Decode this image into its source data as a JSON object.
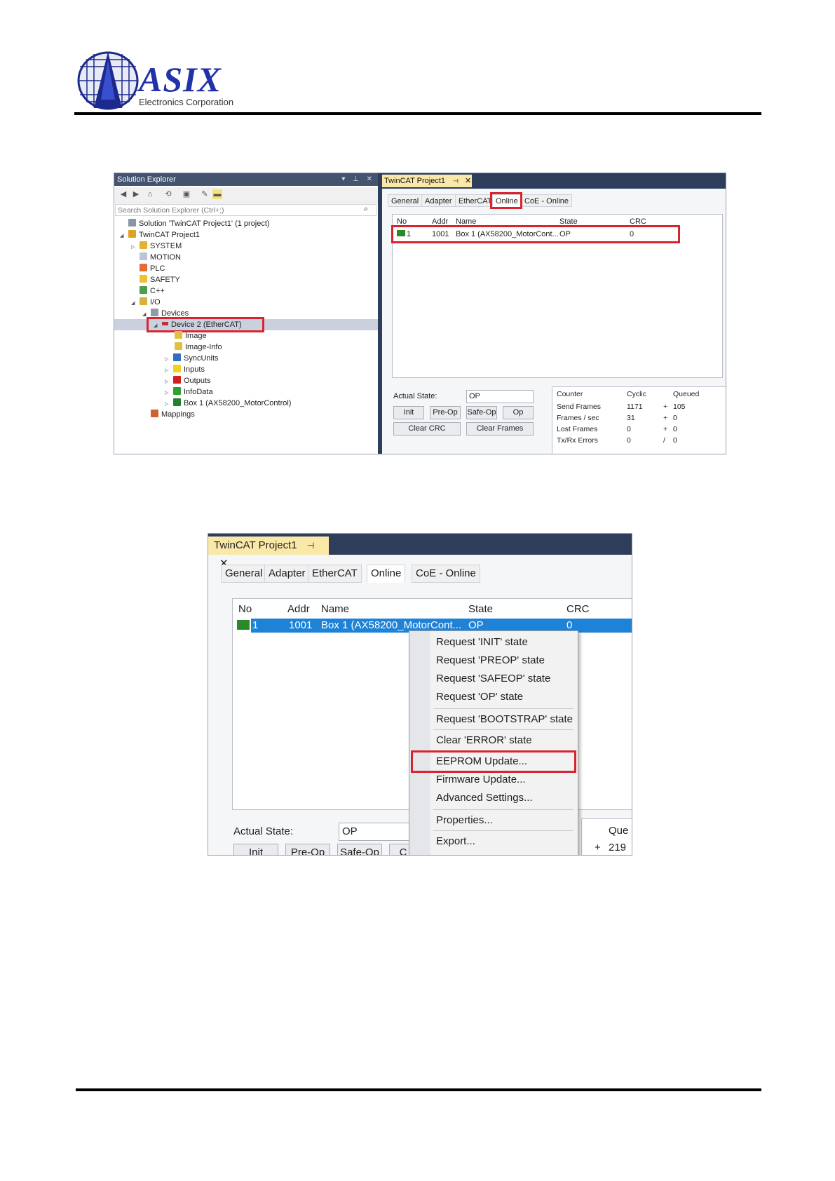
{
  "header": {
    "logo_word": "ASIX",
    "logo_sub": "Electronics Corporation"
  },
  "shot1": {
    "solution_explorer": {
      "title": "Solution Explorer",
      "search_placeholder": "Search Solution Explorer (Ctrl+;)",
      "tree": [
        {
          "label": "Solution 'TwinCAT Project1' (1 project)",
          "icon": "solution-icon"
        },
        {
          "label": "TwinCAT Project1",
          "icon": "twincat-project-icon"
        },
        {
          "label": "SYSTEM",
          "icon": "system-icon"
        },
        {
          "label": "MOTION",
          "icon": "motion-icon"
        },
        {
          "label": "PLC",
          "icon": "plc-icon"
        },
        {
          "label": "SAFETY",
          "icon": "safety-icon"
        },
        {
          "label": "C++",
          "icon": "cpp-icon"
        },
        {
          "label": "I/O",
          "icon": "io-icon"
        },
        {
          "label": "Devices",
          "icon": "devices-icon"
        },
        {
          "label": "Device 2 (EtherCAT)",
          "icon": "ethercat-device-icon"
        },
        {
          "label": "Image",
          "icon": "image-icon"
        },
        {
          "label": "Image-Info",
          "icon": "image-info-icon"
        },
        {
          "label": "SyncUnits",
          "icon": "syncunits-icon"
        },
        {
          "label": "Inputs",
          "icon": "inputs-icon"
        },
        {
          "label": "Outputs",
          "icon": "outputs-icon"
        },
        {
          "label": "InfoData",
          "icon": "infodata-icon"
        },
        {
          "label": "Box 1 (AX58200_MotorControl)",
          "icon": "box-icon"
        },
        {
          "label": "Mappings",
          "icon": "mappings-icon"
        }
      ]
    },
    "twincat": {
      "tab_title": "TwinCAT Project1",
      "subtabs": [
        "General",
        "Adapter",
        "EtherCAT",
        "Online",
        "CoE - Online"
      ],
      "columns": [
        "No",
        "Addr",
        "Name",
        "State",
        "CRC"
      ],
      "row": {
        "no": "1",
        "addr": "1001",
        "name": "Box 1 (AX58200_MotorCont...",
        "state": "OP",
        "crc": "0"
      },
      "actual_state_label": "Actual State:",
      "actual_state_value": "OP",
      "buttons": [
        "Init",
        "Pre-Op",
        "Safe-Op",
        "Op",
        "Clear CRC",
        "Clear Frames"
      ],
      "stats_header": [
        "Counter",
        "Cyclic",
        "Queued"
      ],
      "stats_rows": [
        {
          "counter": "Send Frames",
          "cyclic": "1171",
          "op": "+",
          "queued": "105"
        },
        {
          "counter": "Frames / sec",
          "cyclic": "31",
          "op": "+",
          "queued": "0"
        },
        {
          "counter": "Lost Frames",
          "cyclic": "0",
          "op": "+",
          "queued": "0"
        },
        {
          "counter": "Tx/Rx Errors",
          "cyclic": "0",
          "op": "/",
          "queued": "0"
        }
      ]
    }
  },
  "shot2": {
    "tab_title": "TwinCAT Project1",
    "subtabs": [
      "General",
      "Adapter",
      "EtherCAT",
      "Online",
      "CoE - Online"
    ],
    "columns": [
      "No",
      "Addr",
      "Name",
      "State",
      "CRC"
    ],
    "row": {
      "no": "1",
      "addr": "1001",
      "name": "Box 1 (AX58200_MotorCont...",
      "state": "OP",
      "crc": "0"
    },
    "context_menu": [
      "Request 'INIT' state",
      "Request 'PREOP' state",
      "Request 'SAFEOP' state",
      "Request 'OP' state",
      "Request 'BOOTSTRAP' state",
      "Clear 'ERROR' state",
      "EEPROM Update...",
      "Firmware Update...",
      "Advanced Settings...",
      "Properties...",
      "Export..."
    ],
    "actual_state_label": "Actual State:",
    "actual_state_value": "OP",
    "buttons": [
      "Init",
      "Pre-Op",
      "Safe-Op",
      "C"
    ],
    "partial_queued_header": "Que",
    "partial_op": "+",
    "partial_queued_value": "219"
  },
  "colors": {
    "highlight": "#d9232e",
    "selection": "#1e82d7",
    "tab_active": "#f9e8a8",
    "chrome": "#2d3d5a"
  }
}
